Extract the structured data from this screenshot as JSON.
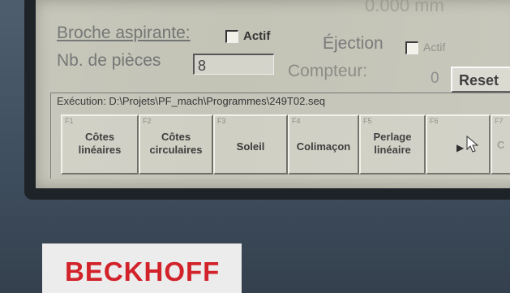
{
  "top_cut": {
    "value": "0.000 mm"
  },
  "broche": {
    "label": "Broche aspirante:",
    "checkbox_label": "Actif"
  },
  "ejection": {
    "label": "Éjection",
    "checkbox_label": "Actif"
  },
  "pieces": {
    "label": "Nb. de pièces",
    "value": "8"
  },
  "compteur": {
    "label": "Compteur:",
    "value": "0",
    "reset_label": "Reset"
  },
  "execution": {
    "text": "Exécution: D:\\Projets\\PF_mach\\Programmes\\249T02.seq"
  },
  "fkeys": [
    {
      "num": "F1",
      "label": "Côtes\nlinéaires"
    },
    {
      "num": "F2",
      "label": "Côtes\ncirculaires"
    },
    {
      "num": "F3",
      "label": "Soleil"
    },
    {
      "num": "F4",
      "label": "Colimaçon"
    },
    {
      "num": "F5",
      "label": "Perlage\nlinéaire"
    },
    {
      "num": "F6",
      "label": ""
    },
    {
      "num": "F7",
      "label": "C"
    }
  ],
  "brand": {
    "logo": "BECKHOFF"
  },
  "colors": {
    "screen": "#c3c3b6",
    "bezel": "#1e2328",
    "brand_red": "#d2222a"
  }
}
